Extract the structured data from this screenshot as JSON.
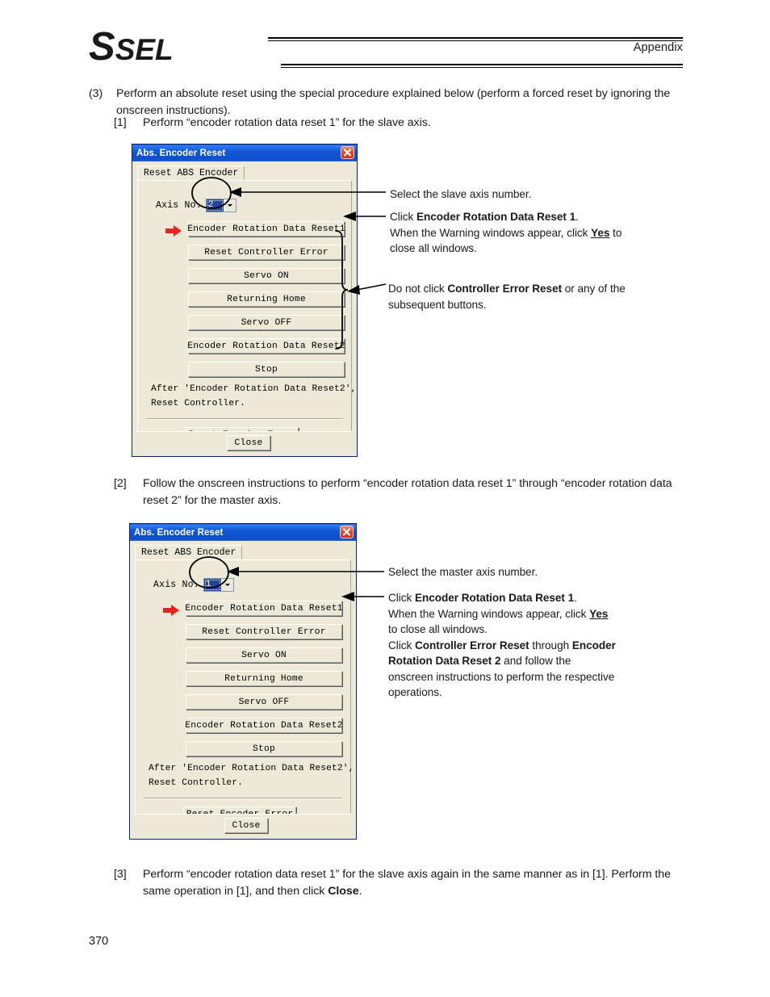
{
  "header": {
    "logo_s": "S",
    "logo_sel": "SEL",
    "section": "Appendix"
  },
  "page_number": "370",
  "steps": {
    "step3_marker": "(3)",
    "step3_text": "Perform an absolute reset using the special procedure explained below (perform a forced reset by ignoring the onscreen instructions).",
    "step1_marker": "[1]",
    "step1_text": "Perform “encoder rotation data reset 1” for the slave axis.",
    "step2_marker": "[2]",
    "step2_text": "Follow the onscreen instructions to perform “encoder rotation data reset 1” through “encoder rotation data reset 2” for the master axis.",
    "step3b_marker": "[3]",
    "step3b_text_part1": "Perform “encoder rotation data reset 1” for the slave axis again in the same manner as in [1]. Perform the same operation in [1], and then click ",
    "step3b_bold": "Close",
    "step3b_text_part2": "."
  },
  "dialog1": {
    "title": "Abs. Encoder Reset",
    "close_icon": "close-icon",
    "tab_label": "Reset ABS Encoder",
    "axis_label": "Axis No.",
    "axis_value": "2",
    "buttons": [
      "Encoder Rotation Data Reset1",
      "Reset Controller Error",
      "Servo ON",
      "Returning Home",
      "Servo OFF",
      "Encoder Rotation Data Reset2",
      "Stop"
    ],
    "note_line1": "After 'Encoder Rotation Data Reset2',",
    "note_line2": "Reset Controller.",
    "reset_encoder_error": "Reset Encoder Error",
    "close_button": "Close"
  },
  "dialog2": {
    "title": "Abs. Encoder Reset",
    "close_icon": "close-icon",
    "tab_label": "Reset ABS Encoder",
    "axis_label": "Axis No.",
    "axis_value": "1",
    "buttons": [
      "Encoder Rotation Data Reset1",
      "Reset Controller Error",
      "Servo ON",
      "Returning Home",
      "Servo OFF",
      "Encoder Rotation Data Reset2",
      "Stop"
    ],
    "note_line1": "After 'Encoder Rotation Data Reset2',",
    "note_line2": "Reset Controller.",
    "reset_encoder_error": "Reset Encoder Error",
    "close_button": "Close"
  },
  "callouts1": {
    "axis": "Select the slave axis number.",
    "reset1_pre": "Click ",
    "reset1_bold": "Encoder Rotation Data Reset 1",
    "reset1_post": ".",
    "reset1_line2_pre": "When the Warning windows appear, click ",
    "reset1_line2_bold": "Yes",
    "reset1_line2_post": " to",
    "reset1_line3": "close all windows.",
    "donot_pre": "Do not click ",
    "donot_bold": "Controller Error Reset",
    "donot_post": " or any of the",
    "donot_line2": "subsequent buttons."
  },
  "callouts2": {
    "axis": "Select the master axis number.",
    "reset1_pre": "Click ",
    "reset1_bold": "Encoder Rotation Data Reset 1",
    "reset1_post": ".",
    "reset1_line2_pre": "When the Warning windows appear, click ",
    "reset1_line2_bold": "Yes",
    "reset1_line3": "to close all windows.",
    "cer_pre": "Click ",
    "cer_bold1": "Controller Error Reset",
    "cer_mid": " through ",
    "cer_bold2": "Encoder",
    "cer_bold3": "Rotation Data Reset 2",
    "cer_post": " and follow the",
    "cer_line3": "onscreen instructions to perform the respective",
    "cer_line4": "operations."
  }
}
